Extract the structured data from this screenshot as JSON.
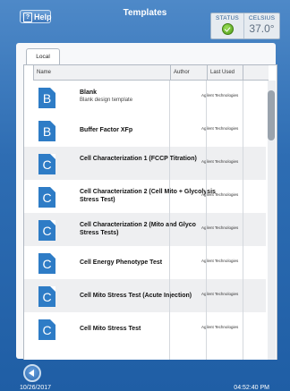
{
  "header": {
    "help_label": "Help",
    "title": "Templates",
    "status_label": "STATUS",
    "celsius_label": "CELSIUS",
    "temperature": "37.0°"
  },
  "tabs": [
    {
      "label": "Local"
    }
  ],
  "columns": {
    "name": "Name",
    "author": "Author",
    "last_used": "Last Used"
  },
  "rows": [
    {
      "icon": "B",
      "name": "Blank",
      "sub": "Blank design template",
      "author": "Agilent Technologies",
      "last_used": ""
    },
    {
      "icon": "B",
      "name": "Buffer Factor XFp",
      "sub": "",
      "author": "Agilent Technologies",
      "last_used": ""
    },
    {
      "icon": "C",
      "name": "Cell Characterization 1 (FCCP Titration)",
      "sub": "",
      "author": "Agilent Technologies",
      "last_used": ""
    },
    {
      "icon": "C",
      "name": "Cell Characterization 2 (Cell Mito + Glycolysis Stress Test)",
      "sub": "",
      "author": "Agilent Technologies",
      "last_used": ""
    },
    {
      "icon": "C",
      "name": "Cell Characterization 2 (Mito and Glyco Stress Tests)",
      "sub": "",
      "author": "Agilent Technologies",
      "last_used": ""
    },
    {
      "icon": "C",
      "name": "Cell Energy Phenotype Test",
      "sub": "",
      "author": "Agilent Technologies",
      "last_used": ""
    },
    {
      "icon": "C",
      "name": "Cell Mito Stress Test (Acute Injection)",
      "sub": "",
      "author": "Agilent Technologies",
      "last_used": ""
    },
    {
      "icon": "C",
      "name": "Cell Mito Stress Test",
      "sub": "",
      "author": "Agilent Technologies",
      "last_used": ""
    }
  ],
  "footer": {
    "date": "10/26/2017",
    "time": "04:52:40 PM"
  },
  "colors": {
    "background": "#2e6db3",
    "status_ok": "#5aa81f",
    "icon_blue": "#2e7cc6"
  }
}
